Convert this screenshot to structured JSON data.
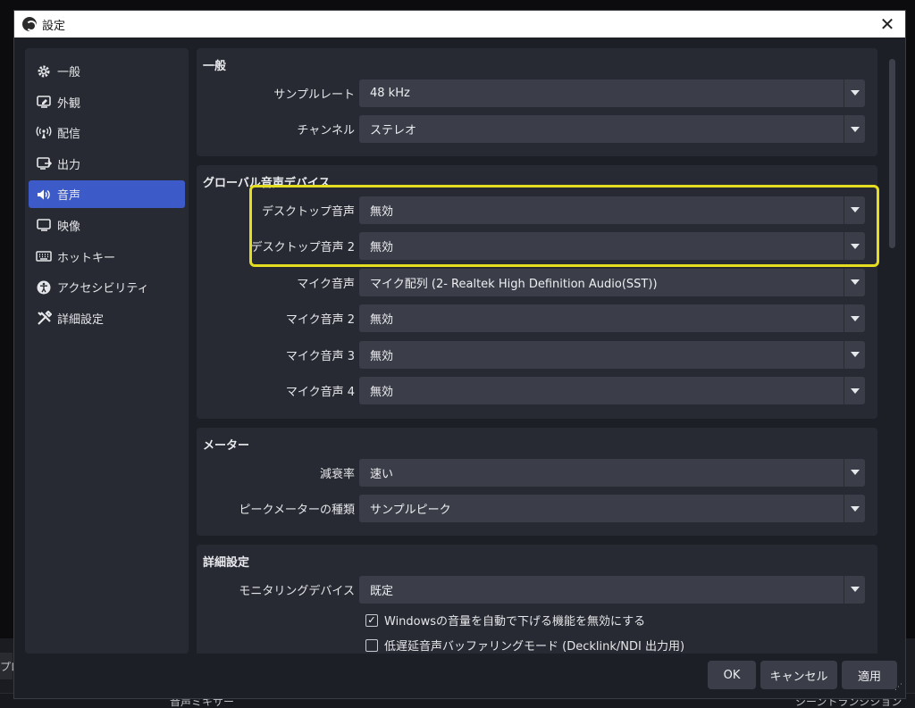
{
  "background": {
    "left_input_text": "プロ",
    "bottom_left_text": "音声ミキサー",
    "bottom_right_text": "シーントランジション"
  },
  "window": {
    "title": "設定",
    "close_glyph": "✕"
  },
  "sidebar": {
    "items": [
      {
        "label": "一般",
        "icon": "gear-icon",
        "active": false
      },
      {
        "label": "外観",
        "icon": "appearance-icon",
        "active": false
      },
      {
        "label": "配信",
        "icon": "broadcast-icon",
        "active": false
      },
      {
        "label": "出力",
        "icon": "output-icon",
        "active": false
      },
      {
        "label": "音声",
        "icon": "speaker-icon",
        "active": true
      },
      {
        "label": "映像",
        "icon": "monitor-icon",
        "active": false
      },
      {
        "label": "ホットキー",
        "icon": "keyboard-icon",
        "active": false
      },
      {
        "label": "アクセシビリティ",
        "icon": "accessibility-icon",
        "active": false
      },
      {
        "label": "詳細設定",
        "icon": "tools-icon",
        "active": false
      }
    ]
  },
  "general": {
    "title": "一般",
    "sample_rate": {
      "label": "サンプルレート",
      "value": "48 kHz"
    },
    "channels": {
      "label": "チャンネル",
      "value": "ステレオ"
    }
  },
  "global_audio": {
    "title": "グローバル音声デバイス",
    "desktop1": {
      "label": "デスクトップ音声",
      "value": "無効"
    },
    "desktop2": {
      "label": "デスクトップ音声 2",
      "value": "無効"
    },
    "mic1": {
      "label": "マイク音声",
      "value": "マイク配列 (2- Realtek High Definition Audio(SST))"
    },
    "mic2": {
      "label": "マイク音声 2",
      "value": "無効"
    },
    "mic3": {
      "label": "マイク音声 3",
      "value": "無効"
    },
    "mic4": {
      "label": "マイク音声 4",
      "value": "無効"
    }
  },
  "meters": {
    "title": "メーター",
    "decay": {
      "label": "減衰率",
      "value": "速い"
    },
    "peak_type": {
      "label": "ピークメーターの種類",
      "value": "サンプルピーク"
    }
  },
  "advanced": {
    "title": "詳細設定",
    "monitoring": {
      "label": "モニタリングデバイス",
      "value": "既定"
    },
    "ducking": {
      "label": "Windowsの音量を自動で下げる機能を無効にする",
      "checked": true,
      "check_glyph": "✓"
    },
    "low_latency": {
      "label": "低遅延音声バッファリングモード (Decklink/NDI 出力用)",
      "checked": false
    }
  },
  "buttons": {
    "ok": "OK",
    "cancel": "キャンセル",
    "apply": "適用"
  },
  "colors": {
    "accent": "#3d5ac9",
    "highlight": "#e5dd1f"
  }
}
